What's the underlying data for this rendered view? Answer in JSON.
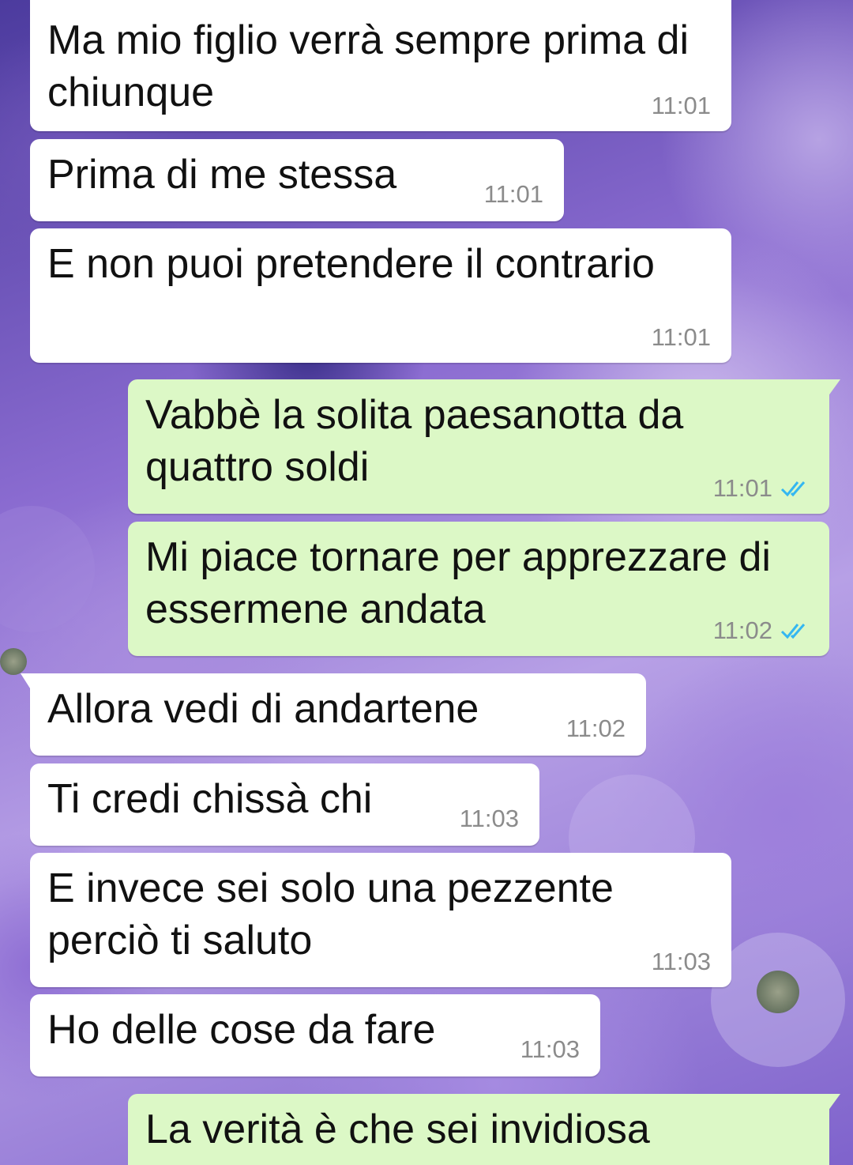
{
  "messages": [
    {
      "text": "Ma mio figlio verrà sempre prima di chiunque",
      "time": "11:01"
    },
    {
      "text": "Prima di me stessa",
      "time": "11:01"
    },
    {
      "text": "E non puoi pretendere il contrario",
      "time": "11:01"
    },
    {
      "text": "Vabbè la solita paesanotta da quattro soldi",
      "time": "11:01",
      "read_status": "read"
    },
    {
      "text": "Mi piace tornare per apprezzare di essermene andata",
      "time": "11:02",
      "read_status": "read"
    },
    {
      "text": "Allora vedi di andartene",
      "time": "11:02"
    },
    {
      "text": "Ti credi chissà chi",
      "time": "11:03"
    },
    {
      "text": "E invece sei solo una pezzente perciò ti saluto",
      "time": "11:03"
    },
    {
      "text": "Ho delle cose da fare",
      "time": "11:03"
    },
    {
      "text": "La verità è che sei invidiosa",
      "time": ""
    }
  ],
  "colors": {
    "incoming_bubble": "#ffffff",
    "outgoing_bubble": "#dcf8c6",
    "read_ticks": "#34b7f1",
    "timestamp": "#8b8b8b"
  },
  "icons": {
    "read_receipt": "double-check-icon"
  }
}
